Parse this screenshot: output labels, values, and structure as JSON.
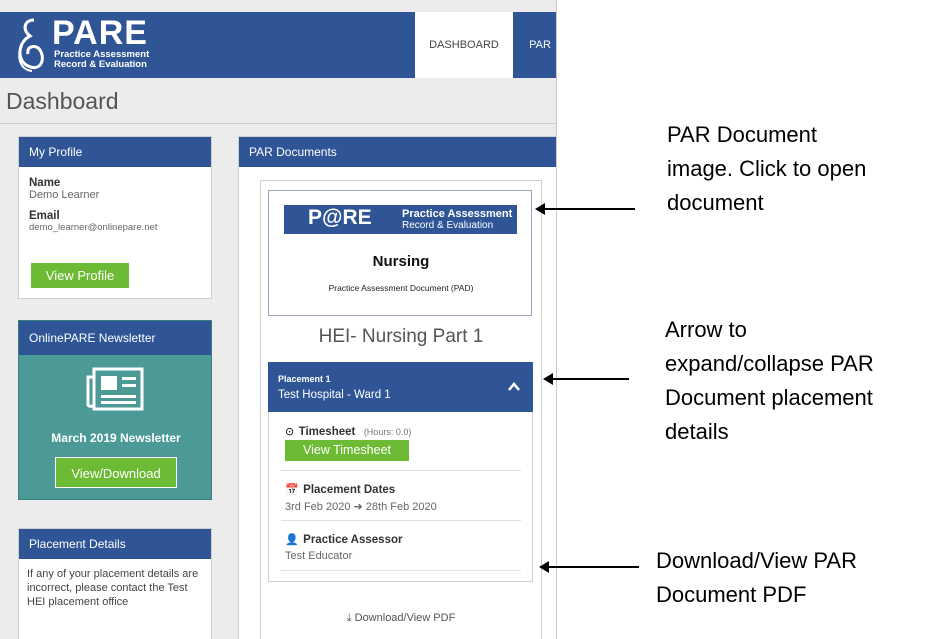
{
  "header": {
    "logo": {
      "word": "PARE",
      "line1": "Practice Assessment",
      "line2": "Record & Evaluation"
    },
    "nav": {
      "dashboard": "DASHBOARD",
      "par": "PAR"
    }
  },
  "page_title": "Dashboard",
  "my_profile": {
    "title": "My Profile",
    "name_label": "Name",
    "name_value": "Demo Learner",
    "email_label": "Email",
    "email_value": "demo_learner@onlinepare.net",
    "button": "View Profile"
  },
  "newsletter": {
    "title": "OnlinePARE Newsletter",
    "icon": "newspaper-icon",
    "headline": "March 2019 Newsletter",
    "button": "View/Download"
  },
  "placement_details_panel": {
    "title": "Placement Details",
    "text": "If any of your placement details are incorrect, please contact the Test HEI placement office"
  },
  "par_documents": {
    "title": "PAR Documents",
    "card": {
      "logo_word": "P@RE",
      "logo_line1": "Practice Assessment",
      "logo_line2": "Record & Evaluation",
      "heading": "Nursing",
      "subheading": "Practice Assessment Document (PAD)"
    },
    "course": "HEI- Nursing Part 1",
    "placement": {
      "label": "Placement 1",
      "location": "Test Hospital - Ward 1",
      "timesheet_label": "Timesheet",
      "timesheet_hours": "(Hours: 0.0)",
      "timesheet_button": "View Timesheet",
      "dates_label": "Placement Dates",
      "dates_start": "3rd Feb 2020",
      "dates_end": "28th Feb 2020",
      "assessor_label": "Practice Assessor",
      "assessor_value": "Test Educator"
    },
    "download_link": "Download/View PDF"
  },
  "annotations": {
    "a1": [
      "PAR Document",
      "image. Click to open",
      "document"
    ],
    "a2": [
      "Arrow to",
      "expand/collapse PAR",
      "Document placement",
      "details"
    ],
    "a3": [
      "Download/View PAR",
      "Document PDF"
    ]
  },
  "colors": {
    "brand_blue": "#2f5597",
    "button_green": "#6dbb34",
    "newsletter_teal": "#4b9a96"
  }
}
